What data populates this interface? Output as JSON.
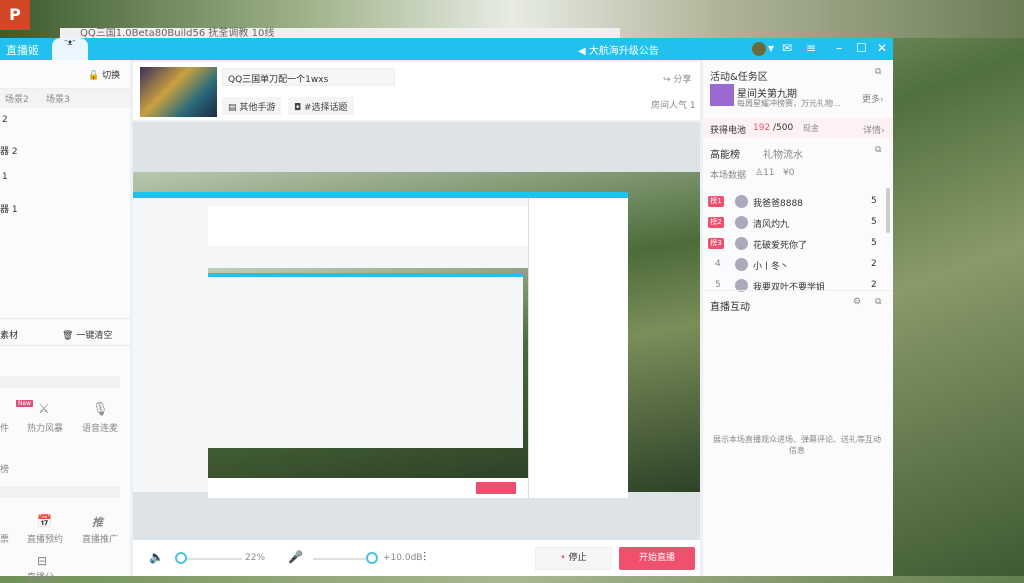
{
  "desktop": {
    "window_title": "QQ三国1.0Beta80Build56 抚荃调教 10线",
    "ppt_label": "P"
  },
  "app": {
    "name": "直播姬",
    "notice": "大航海升级公告",
    "accent": "#22c0ee",
    "live_color": "#f0506e"
  },
  "left": {
    "switch": "切换",
    "scenes": [
      "场景2",
      "场景3"
    ],
    "sources": [
      "2",
      "器 2",
      "1",
      "器 1"
    ],
    "material": "素材",
    "clear": "一键清空",
    "new_badge": "New",
    "tools1": [
      {
        "label": "件",
        "icon": "plugin-icon"
      },
      {
        "label": "热力风暴",
        "icon": "heat-storm-icon"
      },
      {
        "label": "语音连麦",
        "icon": "voice-link-icon"
      }
    ],
    "section2": "榜",
    "tools2": [
      {
        "label": "票",
        "icon": "ticket-icon"
      },
      {
        "label": "直播预约",
        "icon": "calendar-icon"
      },
      {
        "label": "直播推广",
        "icon": "promote-icon"
      }
    ],
    "tools3": [
      {
        "label": "直播分...",
        "icon": "share-box-icon"
      }
    ]
  },
  "header": {
    "title": "QQ三国单刀配一个1wxs",
    "category": "其他手游",
    "topic": "#选择话题",
    "share": "分享",
    "popularity": "房间人气 1"
  },
  "bottom": {
    "volume": "22%",
    "volume_level": 0.22,
    "mic": "+10.0dB",
    "mic_level": 1.0,
    "stop": "停止",
    "start": "开始直播"
  },
  "right": {
    "activity_title": "活动&任务区",
    "event_name": "星间关第九期",
    "event_desc": "每周星耀冲榜赛，万元礼物...",
    "more": "更多",
    "battery_label": "获得电池",
    "battery_value": "192",
    "battery_total": "/500",
    "cash": "现金",
    "details": "详情",
    "tab_rank": "高能榜",
    "tab_gift": "礼物流水",
    "stats_label": "本场数据",
    "viewers": "11",
    "income": "¥0",
    "ranking": [
      {
        "rank": "榜1",
        "name": "我爸爸8888",
        "score": "5"
      },
      {
        "rank": "榜2",
        "name": "清风灼九",
        "score": "5"
      },
      {
        "rank": "榜3",
        "name": "花破爱死你了",
        "score": "5"
      },
      {
        "rank": "4",
        "name": "小丨冬丶",
        "score": "2"
      },
      {
        "rank": "5",
        "name": "我要双叶不要学姐",
        "score": "2"
      }
    ],
    "interact_title": "直播互动",
    "interact_desc": "展示本场直播观众进场、弹幕评论、送礼等互动信息"
  }
}
